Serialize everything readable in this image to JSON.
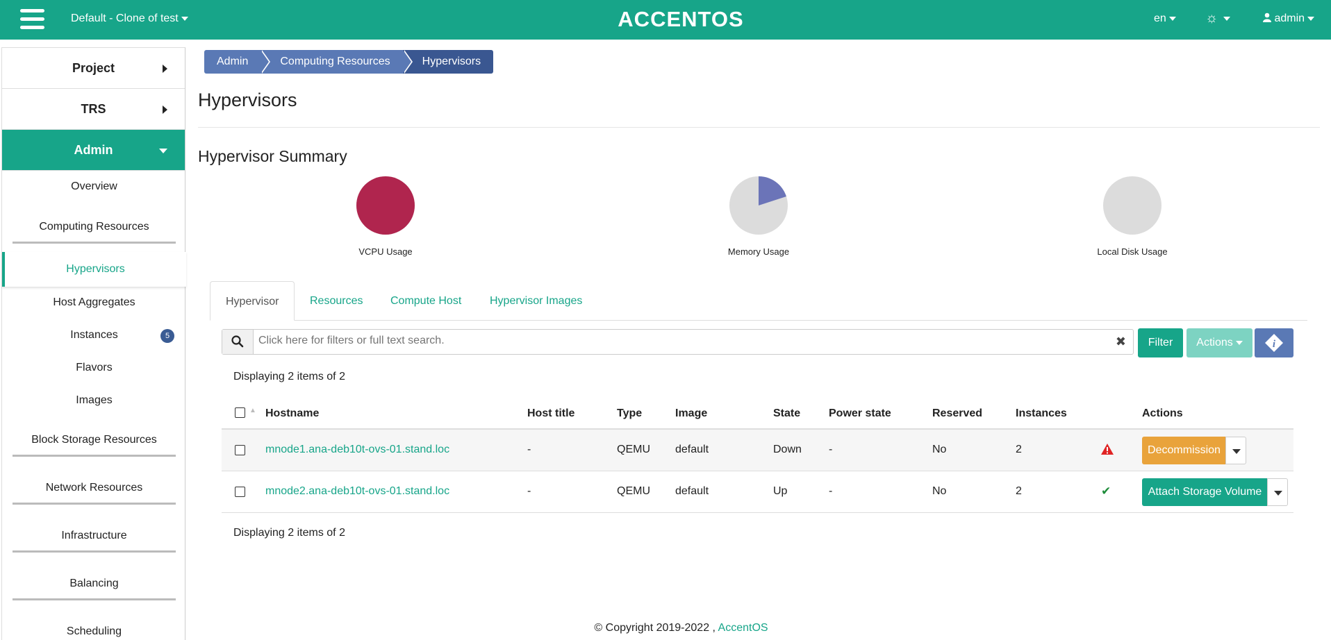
{
  "topbar": {
    "project": "Default - Clone of test",
    "logo": "ACCENTOS",
    "lang": "en",
    "user": "admin"
  },
  "sidebar": {
    "project": "Project",
    "trs": "TRS",
    "admin": "Admin",
    "items": {
      "overview": "Overview",
      "computing": "Computing Resources",
      "hypervisors": "Hypervisors",
      "host_aggregates": "Host Aggregates",
      "instances": "Instances",
      "instances_badge": "5",
      "flavors": "Flavors",
      "images": "Images",
      "block_storage": "Block Storage Resources",
      "network": "Network Resources",
      "infrastructure": "Infrastructure",
      "balancing": "Balancing",
      "scheduling": "Scheduling"
    }
  },
  "breadcrumb": [
    "Admin",
    "Computing Resources",
    "Hypervisors"
  ],
  "page_title": "Hypervisors",
  "summary": {
    "title": "Hypervisor Summary",
    "charts": [
      {
        "label": "VCPU Usage",
        "used_fraction": 1.0,
        "color": "#b0254e"
      },
      {
        "label": "Memory Usage",
        "used_fraction": 0.2,
        "color": "#6b74b8"
      },
      {
        "label": "Local Disk Usage",
        "used_fraction": 0.0,
        "color": "#dcdcdc"
      }
    ]
  },
  "tabs": [
    "Hypervisor",
    "Resources",
    "Compute Host",
    "Hypervisor Images"
  ],
  "search": {
    "placeholder": "Click here for filters or full text search."
  },
  "toolbar": {
    "filter": "Filter",
    "actions": "Actions"
  },
  "display_count": "Displaying 2 items of 2",
  "table": {
    "headers": {
      "hostname": "Hostname",
      "host_title": "Host title",
      "type": "Type",
      "image": "Image",
      "state": "State",
      "power_state": "Power state",
      "reserved": "Reserved",
      "instances": "Instances",
      "actions": "Actions"
    },
    "rows": [
      {
        "hostname": "mnode1.ana-deb10t-ovs-01.stand.loc",
        "host_title": "-",
        "type": "QEMU",
        "image": "default",
        "state": "Down",
        "power_state": "-",
        "reserved": "No",
        "instances": "2",
        "status_icon": "warning-icon",
        "action": "Decommission",
        "action_color": "#e9a33b"
      },
      {
        "hostname": "mnode2.ana-deb10t-ovs-01.stand.loc",
        "host_title": "-",
        "type": "QEMU",
        "image": "default",
        "state": "Up",
        "power_state": "-",
        "reserved": "No",
        "instances": "2",
        "status_icon": "check-icon",
        "action": "Attach Storage Volume",
        "action_color": "#17a589"
      }
    ]
  },
  "footer": {
    "copyright": "© Copyright 2019-2022 ,",
    "link": "AccentOS"
  }
}
